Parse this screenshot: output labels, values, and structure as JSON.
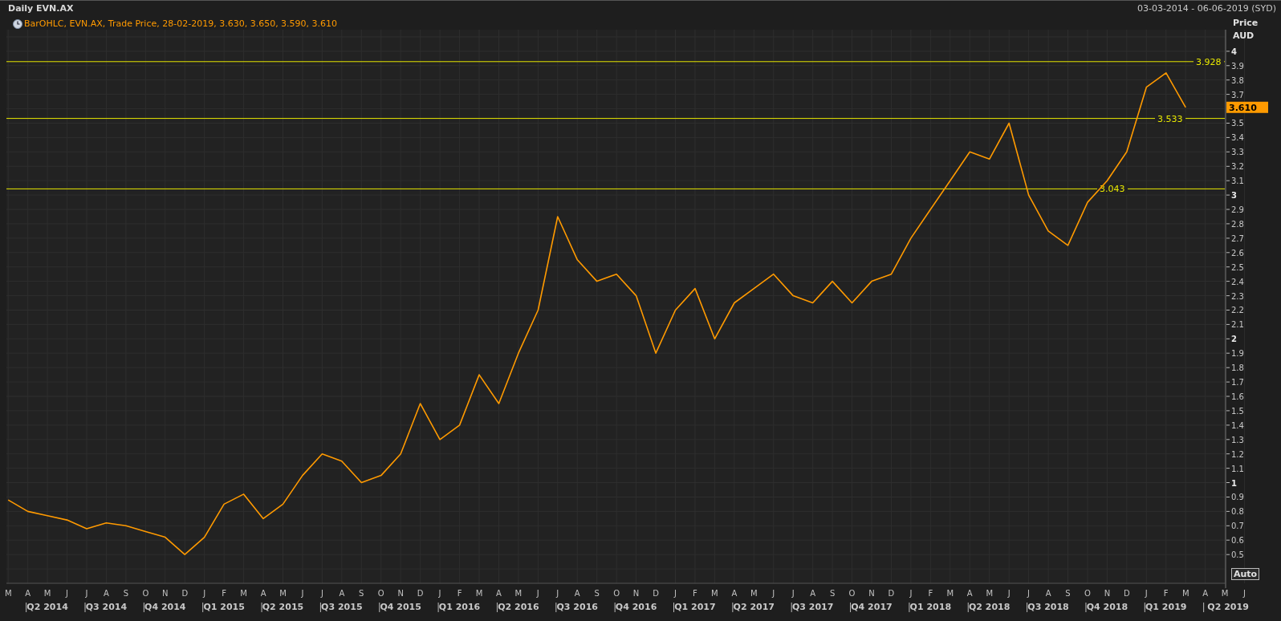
{
  "header": {
    "title": "Daily EVN.AX",
    "date_range": "03-03-2014 - 06-06-2019 (SYD)"
  },
  "legend": {
    "text": "BarOHLC, EVN.AX, Trade Price, 28-02-2019, 3.630, 3.650, 3.590, 3.610"
  },
  "price_axis": {
    "title": "Price",
    "unit": "AUD",
    "last_price": "3.610",
    "auto_button": "Auto"
  },
  "quarters": [
    "Q2 2014",
    "Q3 2014",
    "Q4 2014",
    "Q1 2015",
    "Q2 2015",
    "Q3 2015",
    "Q4 2015",
    "Q1 2016",
    "Q2 2016",
    "Q3 2016",
    "Q4 2016",
    "Q1 2017",
    "Q2 2017",
    "Q3 2017",
    "Q4 2017",
    "Q1 2018",
    "Q2 2018",
    "Q3 2018",
    "Q4 2018",
    "Q1 2019",
    "Q2 2019"
  ],
  "chart_data": {
    "type": "line",
    "x": [
      "M",
      "A",
      "M",
      "J",
      "J",
      "A",
      "S",
      "O",
      "N",
      "D",
      "J",
      "F",
      "M",
      "A",
      "M",
      "J",
      "J",
      "A",
      "S",
      "O",
      "N",
      "D",
      "J",
      "F",
      "M",
      "A",
      "M",
      "J",
      "J",
      "A",
      "S",
      "O",
      "N",
      "D",
      "J",
      "F",
      "M",
      "A",
      "M",
      "J",
      "J",
      "A",
      "S",
      "O",
      "N",
      "D",
      "J",
      "F",
      "M",
      "A",
      "M",
      "J",
      "J",
      "A",
      "S",
      "O",
      "N",
      "D",
      "J",
      "F",
      "M",
      "A",
      "M",
      "J"
    ],
    "series": [
      {
        "color": "#ff9a00",
        "values": [
          0.88,
          0.8,
          0.77,
          0.74,
          0.68,
          0.72,
          0.7,
          0.66,
          0.62,
          0.5,
          0.62,
          0.85,
          0.92,
          0.75,
          0.85,
          1.05,
          1.2,
          1.15,
          1.0,
          1.05,
          1.2,
          1.55,
          1.3,
          1.4,
          1.75,
          1.55,
          1.9,
          2.2,
          2.85,
          2.55,
          2.4,
          2.45,
          2.3,
          1.9,
          2.2,
          2.35,
          2.0,
          2.25,
          2.35,
          2.45,
          2.3,
          2.25,
          2.4,
          2.25,
          2.4,
          2.45,
          2.7,
          2.9,
          3.1,
          3.3,
          3.25,
          3.5,
          3.0,
          2.75,
          2.65,
          2.95,
          3.1,
          3.3,
          3.75,
          3.85,
          3.61,
          null,
          null,
          null
        ]
      }
    ],
    "ylim": [
      0.3,
      4.15
    ],
    "yticks": [
      0.5,
      0.6,
      0.7,
      0.8,
      0.9,
      1,
      1.1,
      1.2,
      1.3,
      1.4,
      1.5,
      1.6,
      1.7,
      1.8,
      1.9,
      2,
      2.1,
      2.2,
      2.3,
      2.4,
      2.5,
      2.6,
      2.7,
      2.8,
      2.9,
      3,
      3.1,
      3.2,
      3.3,
      3.4,
      3.5,
      3.7,
      3.8,
      3.9,
      4
    ],
    "grid": true,
    "ref_lines": [
      {
        "axis": "y",
        "value": 3.928,
        "label": "3.928"
      },
      {
        "axis": "y",
        "value": 3.533,
        "label": "3.533"
      },
      {
        "axis": "y",
        "value": 3.043,
        "label": "3.043"
      }
    ]
  }
}
